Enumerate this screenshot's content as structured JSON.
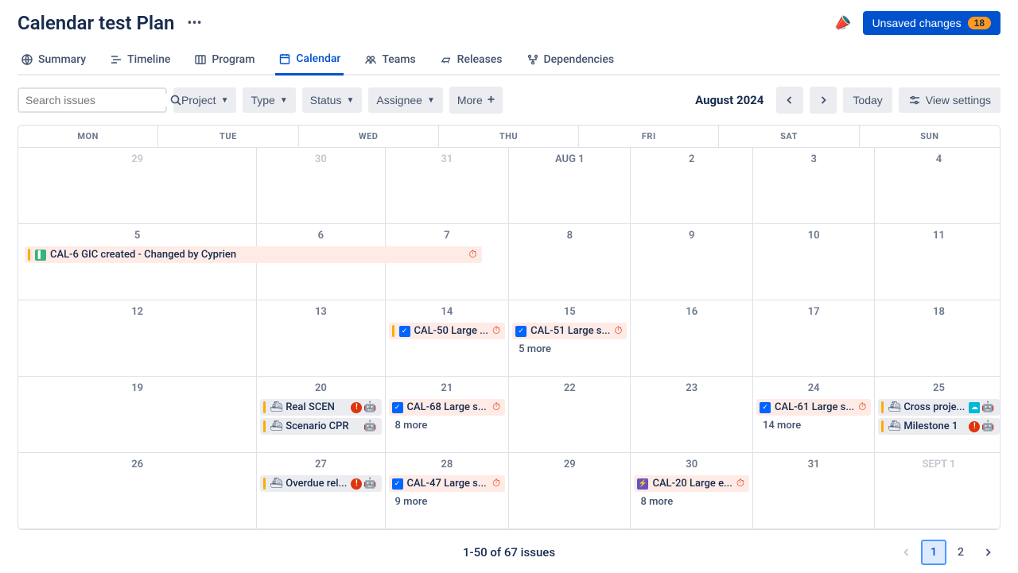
{
  "header": {
    "title": "Calendar test Plan",
    "unsaved_label": "Unsaved changes",
    "unsaved_count": "18"
  },
  "tabs": [
    {
      "id": "summary",
      "label": "Summary"
    },
    {
      "id": "timeline",
      "label": "Timeline"
    },
    {
      "id": "program",
      "label": "Program"
    },
    {
      "id": "calendar",
      "label": "Calendar"
    },
    {
      "id": "teams",
      "label": "Teams"
    },
    {
      "id": "releases",
      "label": "Releases"
    },
    {
      "id": "dependencies",
      "label": "Dependencies"
    }
  ],
  "toolbar": {
    "search_placeholder": "Search issues",
    "filters": {
      "project": "Project",
      "type": "Type",
      "status": "Status",
      "assignee": "Assignee",
      "more": "More"
    },
    "month_label": "August 2024",
    "today_label": "Today",
    "view_settings_label": "View settings"
  },
  "calendar": {
    "day_headers": [
      "MON",
      "TUE",
      "WED",
      "THU",
      "FRI",
      "SAT",
      "SUN"
    ],
    "weeks": [
      [
        {
          "date": "29",
          "outside": true
        },
        {
          "date": "30",
          "outside": true
        },
        {
          "date": "31",
          "outside": true
        },
        {
          "date": "AUG 1"
        },
        {
          "date": "2"
        },
        {
          "date": "3"
        },
        {
          "date": "4"
        }
      ],
      [
        {
          "date": "5"
        },
        {
          "date": "6"
        },
        {
          "date": "7"
        },
        {
          "date": "8"
        },
        {
          "date": "9"
        },
        {
          "date": "10"
        },
        {
          "date": "11"
        }
      ],
      [
        {
          "date": "12"
        },
        {
          "date": "13"
        },
        {
          "date": "14"
        },
        {
          "date": "15"
        },
        {
          "date": "16"
        },
        {
          "date": "17"
        },
        {
          "date": "18"
        }
      ],
      [
        {
          "date": "19"
        },
        {
          "date": "20"
        },
        {
          "date": "21"
        },
        {
          "date": "22"
        },
        {
          "date": "23"
        },
        {
          "date": "24"
        },
        {
          "date": "25"
        }
      ],
      [
        {
          "date": "26"
        },
        {
          "date": "27"
        },
        {
          "date": "28"
        },
        {
          "date": "29"
        },
        {
          "date": "30"
        },
        {
          "date": "31"
        },
        {
          "date": "SEPT 1",
          "outside": true
        }
      ]
    ],
    "events": {
      "w1_mon_wide": {
        "label": "CAL-6 GIC created - Changed by Cyprien"
      },
      "w2_wed": {
        "label": "CAL-50 Large ..."
      },
      "w2_thu": {
        "label": "CAL-51 Large s...",
        "more": "5 more"
      },
      "w3_tue_a": {
        "label": "Real SCEN"
      },
      "w3_tue_b": {
        "label": "Scenario CPR"
      },
      "w3_wed": {
        "label": "CAL-68 Large s...",
        "more": "8 more"
      },
      "w3_sat": {
        "label": "CAL-61 Large s...",
        "more": "14 more"
      },
      "w3_sun_a": {
        "label": "Cross proje..."
      },
      "w3_sun_b": {
        "label": "Milestone 1"
      },
      "w4_tue": {
        "label": "Overdue rel..."
      },
      "w4_wed": {
        "label": "CAL-47 Large s...",
        "more": "9 more"
      },
      "w4_fri": {
        "label": "CAL-20 Large e...",
        "more": "8 more"
      }
    }
  },
  "footer": {
    "count_label": "1-50 of 67 issues",
    "pages": [
      "1",
      "2"
    ]
  }
}
